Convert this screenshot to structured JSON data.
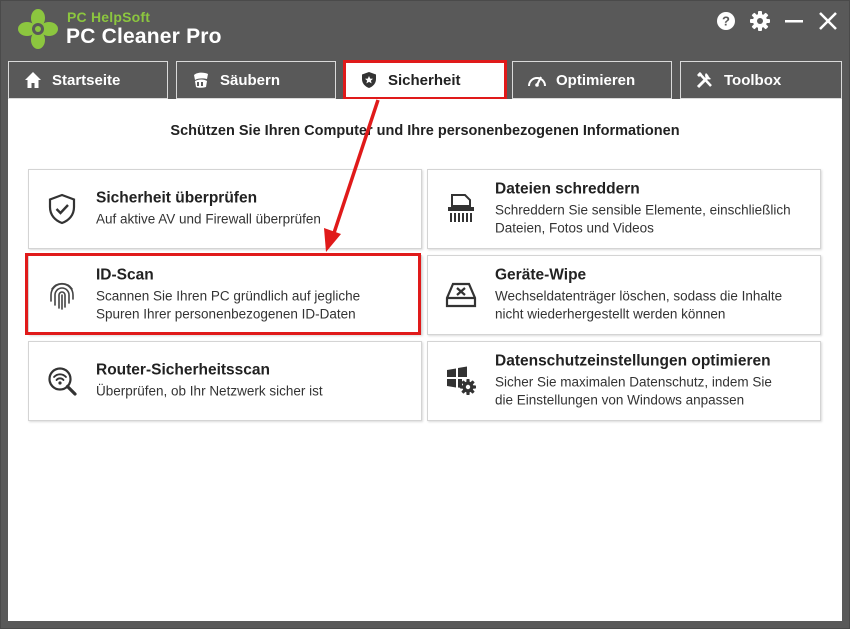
{
  "app": {
    "brand_small": "PC HelpSoft",
    "brand_name": "PC Cleaner Pro",
    "logo_icon": "clover-leaf-logo",
    "accent_color": "#8cc63f",
    "highlight_color": "#e01a1a"
  },
  "window_controls": [
    {
      "name": "help-icon"
    },
    {
      "name": "settings-gear-icon"
    },
    {
      "name": "minimize-icon"
    },
    {
      "name": "close-icon"
    }
  ],
  "tabs": [
    {
      "label": "Startseite",
      "icon": "home-icon",
      "active": false
    },
    {
      "label": "Säubern",
      "icon": "broom-icon",
      "active": false
    },
    {
      "label": "Sicherheit",
      "icon": "shield-icon",
      "active": true
    },
    {
      "label": "Optimieren",
      "icon": "speedometer-icon",
      "active": false
    },
    {
      "label": "Toolbox",
      "icon": "tools-icon",
      "active": false
    }
  ],
  "main": {
    "heading": "Schützen Sie Ihren Computer und Ihre personenbezogenen Informationen",
    "cards": [
      {
        "title": "Sicherheit überprüfen",
        "line1": "Auf aktive AV und Firewall überprüfen",
        "line2": "",
        "icon": "shield-check-icon"
      },
      {
        "title": "Dateien schreddern",
        "line1": "Schreddern Sie sensible Elemente, einschließlich",
        "line2": "Dateien, Fotos und Videos",
        "icon": "shredder-icon"
      },
      {
        "title": "ID-Scan",
        "line1": "Scannen Sie Ihren PC gründlich auf jegliche",
        "line2": "Spuren Ihrer personenbezogenen ID-Daten",
        "icon": "fingerprint-icon"
      },
      {
        "title": "Geräte-Wipe",
        "line1": "Wechseldatenträger löschen, sodass die Inhalte",
        "line2": "nicht wiederhergestellt werden können",
        "icon": "drive-wipe-icon"
      },
      {
        "title": "Router-Sicherheitsscan",
        "line1": "Überprüfen, ob Ihr Netzwerk sicher ist",
        "line2": "",
        "icon": "wifi-search-icon"
      },
      {
        "title": "Datenschutzeinstellungen optimieren",
        "line1": "Sicher Sie maximalen Datenschutz, indem Sie",
        "line2": "die Einstellungen von Windows anpassen",
        "icon": "windows-gear-icon"
      }
    ]
  }
}
